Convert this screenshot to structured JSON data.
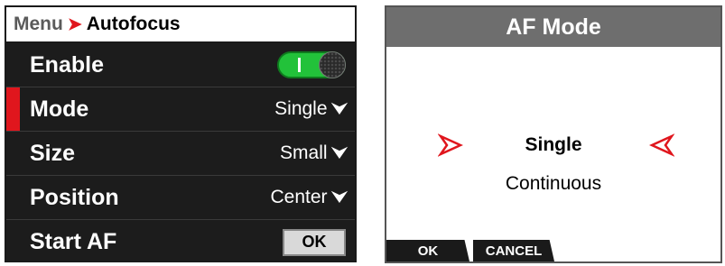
{
  "menu": {
    "breadcrumb": {
      "parent": "Menu",
      "separator": "➤",
      "current": "Autofocus"
    },
    "rows": [
      {
        "label": "Enable",
        "control": "toggle",
        "toggle_on": true
      },
      {
        "label": "Mode",
        "value": "Single",
        "selected": true
      },
      {
        "label": "Size",
        "value": "Small"
      },
      {
        "label": "Position",
        "value": "Center"
      },
      {
        "label": "Start AF",
        "button": "OK"
      }
    ],
    "chevron": "⮟"
  },
  "dialog": {
    "title": "AF Mode",
    "options": [
      {
        "label": "Single",
        "selected": true
      },
      {
        "label": "Continuous",
        "selected": false
      }
    ],
    "buttons": {
      "ok": "OK",
      "cancel": "CANCEL"
    }
  },
  "colors": {
    "accent_red": "#e0161d",
    "toggle_green": "#22c23a",
    "menu_bg": "#1c1c1c",
    "dialog_header": "#6e6e6e"
  },
  "icons": {
    "separator": "chevron-right-icon",
    "dropdown": "chevron-down-icon",
    "selection": "selection-arrow-icon"
  }
}
